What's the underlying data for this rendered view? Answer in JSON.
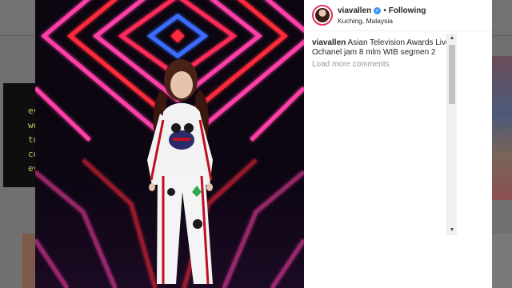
{
  "background": {
    "left_card_lines": [
      "ev",
      "wo",
      "to",
      "ce",
      "ev"
    ]
  },
  "post": {
    "username": "viavallen",
    "follow_label": "Following",
    "location": "Kuching, Malaysia",
    "separator": "•",
    "verified_glyph": "✓"
  },
  "comments": [
    {
      "username": "viavallen",
      "text": "Asian Television Awards Live Ochanel jam 8 mlm WIB segmen 2"
    }
  ],
  "load_more_label": "Load more comments",
  "scrollbar": {
    "up_glyph": "▲",
    "down_glyph": "▼"
  },
  "icons": [
    "verified-badge-icon",
    "scroll-up-icon",
    "scroll-down-icon"
  ],
  "colors": {
    "story_ring": "#e1306c",
    "verified_blue": "#3897f0",
    "neon_pink": "#ff3fa8",
    "neon_red": "#ff2a3a",
    "neon_blue": "#3a6cff"
  }
}
